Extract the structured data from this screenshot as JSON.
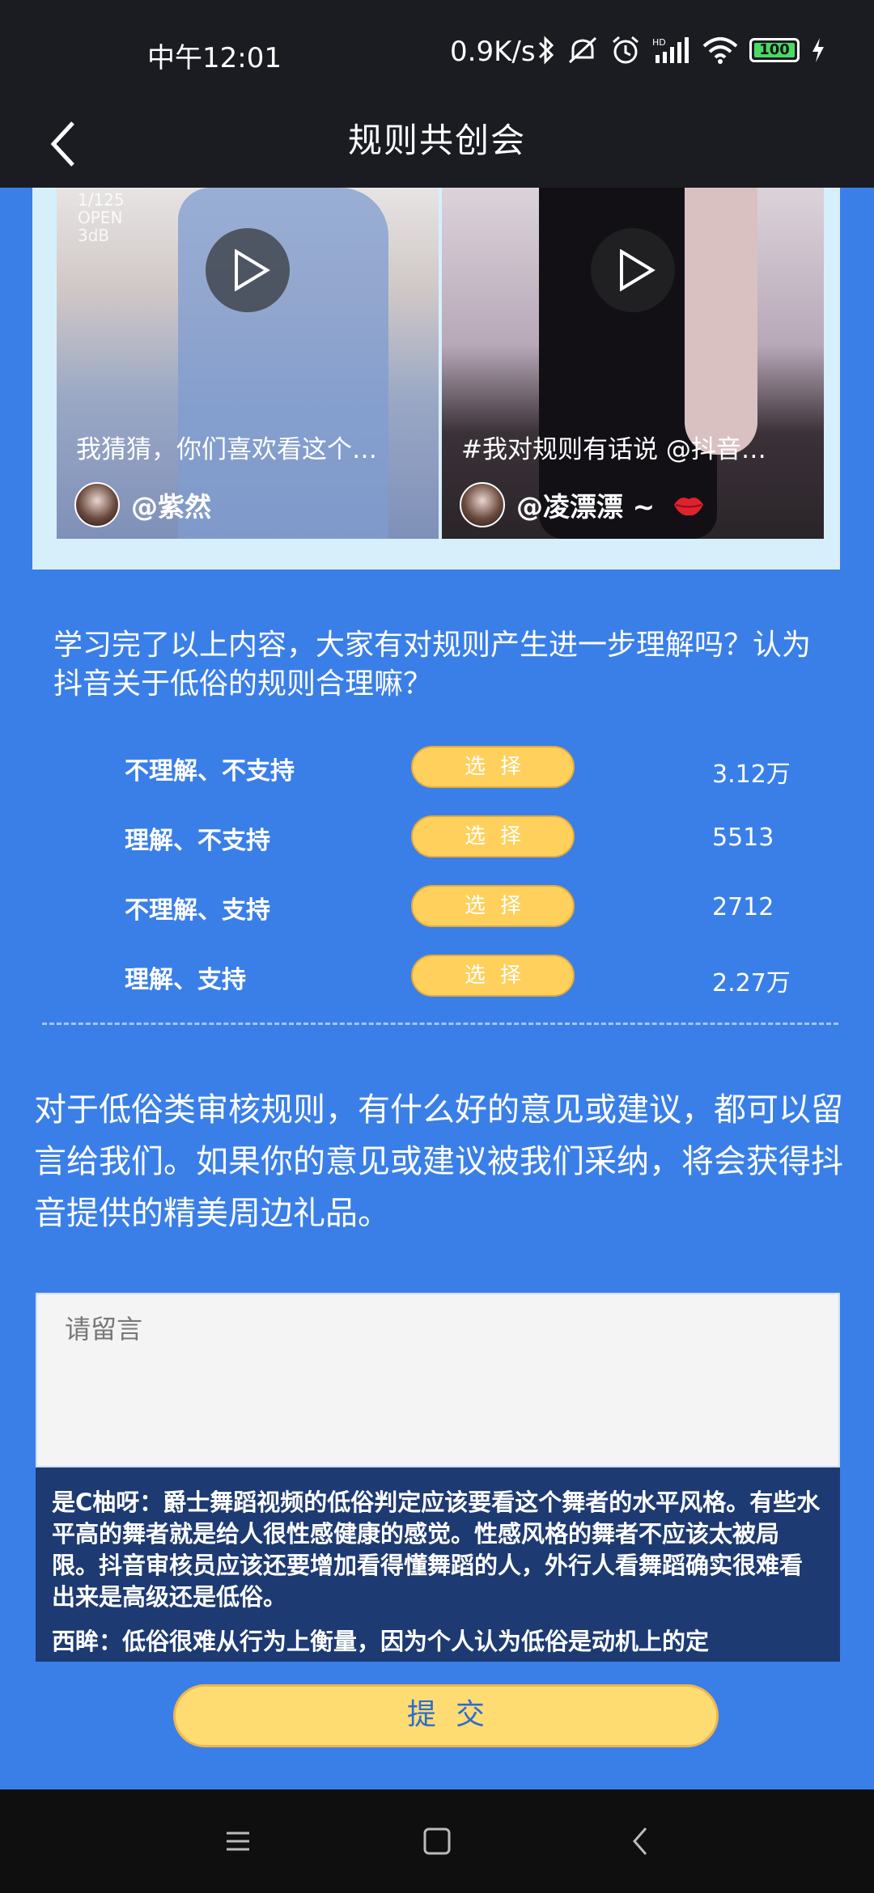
{
  "status_bar": {
    "time": "中午12:01",
    "net_speed": "0.9K/s",
    "battery": "100",
    "icons": [
      "bluetooth-icon",
      "mute-icon",
      "alarm-icon",
      "hd-signal-icon",
      "wifi-icon",
      "battery-icon",
      "charging-icon"
    ]
  },
  "header": {
    "title": "规则共创会",
    "back_icon": "chevron-left-icon"
  },
  "videos": [
    {
      "overlay": "1/125\nOPEN\n3dB",
      "caption": "我猜猜，你们喜欢看这个…",
      "author": "@紫然"
    },
    {
      "caption": "#我对规则有话说 @抖音…",
      "author": "@凌漂漂 ~",
      "author_emoji": "lips-icon"
    }
  ],
  "poll": {
    "question": "学习完了以上内容，大家有对规则产生进一步理解吗？认为抖音关于低俗的规则合理嘛？",
    "button_label": "选择",
    "options": [
      {
        "label": "不理解、不支持",
        "count": "3.12万"
      },
      {
        "label": "理解、不支持",
        "count": "5513"
      },
      {
        "label": "不理解、支持",
        "count": "2712"
      },
      {
        "label": "理解、支持",
        "count": "2.27万"
      }
    ]
  },
  "feedback": {
    "prompt": "对于低俗类审核规则，有什么好的意见或建议，都可以留言给我们。如果你的意见或建议被我们采纳，将会获得抖音提供的精美周边礼品。",
    "placeholder": "请留言",
    "submit_label": "提交"
  },
  "comments": [
    {
      "text": "是C柚呀：爵士舞蹈视频的低俗判定应该要看这个舞者的水平风格。有些水平高的舞者就是给人很性感健康的感觉。性感风格的舞者不应该太被局限。抖音审核员应该还要增加看得懂舞蹈的人，外行人看舞蹈确实很难看出来是高级还是低俗。"
    },
    {
      "text": "西眸：低俗很难从行为上衡量，因为个人认为低俗是动机上的定"
    }
  ],
  "colors": {
    "background": "#3A7FE8",
    "header_bg": "#1B1C22",
    "option_button": "#FFD05C",
    "comment_bg": "#1D3A72",
    "submit_button": "#FFDC72",
    "submit_text": "#2C6BD2"
  },
  "nav_bar": {
    "icons": [
      "menu-icon",
      "home-square-icon",
      "back-triangle-icon"
    ]
  }
}
